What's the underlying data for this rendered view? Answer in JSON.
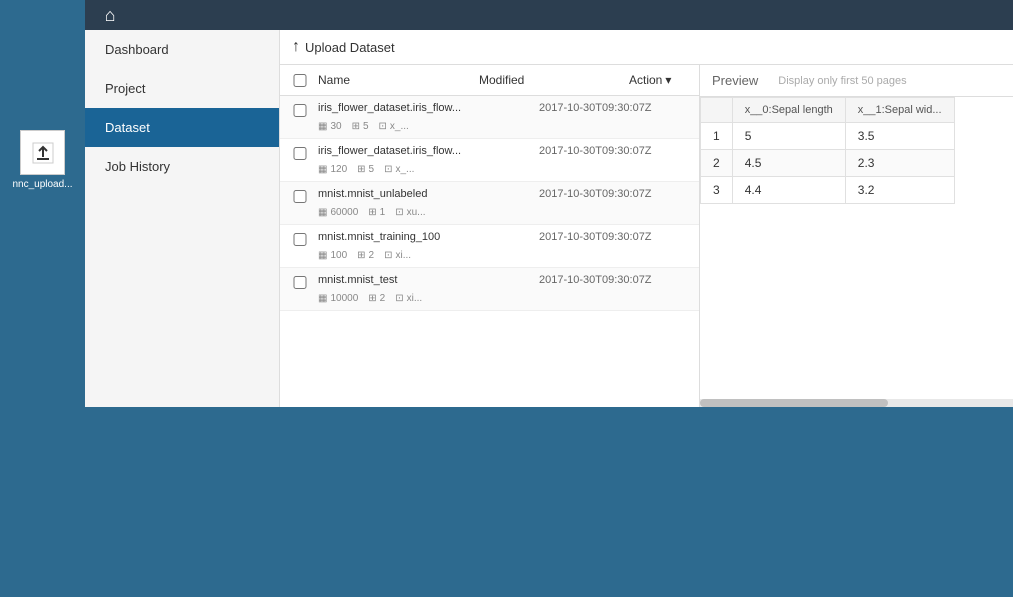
{
  "topbar": {
    "home_icon": "⌂"
  },
  "sidebar": {
    "items": [
      {
        "label": "Dashboard",
        "active": false
      },
      {
        "label": "Project",
        "active": false
      },
      {
        "label": "Dataset",
        "active": true
      },
      {
        "label": "Job History",
        "active": false
      }
    ]
  },
  "toolbar": {
    "upload_label": "Upload Dataset",
    "upload_icon": "↑"
  },
  "table": {
    "headers": {
      "name": "Name",
      "modified": "Modified",
      "action": "Action"
    },
    "rows": [
      {
        "name": "iris_flower_dataset.iris_flow...",
        "modified": "2017-10-30T09:30:07Z",
        "rows": "30",
        "cols": "5",
        "file": "x_..."
      },
      {
        "name": "iris_flower_dataset.iris_flow...",
        "modified": "2017-10-30T09:30:07Z",
        "rows": "120",
        "cols": "5",
        "file": "x_..."
      },
      {
        "name": "mnist.mnist_unlabeled",
        "modified": "2017-10-30T09:30:07Z",
        "rows": "60000",
        "cols": "1",
        "file": "xu..."
      },
      {
        "name": "mnist.mnist_training_100",
        "modified": "2017-10-30T09:30:07Z",
        "rows": "100",
        "cols": "2",
        "file": "xi..."
      },
      {
        "name": "mnist.mnist_test",
        "modified": "2017-10-30T09:30:07Z",
        "rows": "10000",
        "cols": "2",
        "file": "xi..."
      }
    ]
  },
  "preview": {
    "title": "Preview",
    "note": "Display only first 50 pages",
    "columns": [
      {
        "label": ""
      },
      {
        "label": "x__0:Sepal length"
      },
      {
        "label": "x__1:Sepal wid..."
      }
    ],
    "rows": [
      {
        "idx": "1",
        "col0": "5",
        "col1": "3.5"
      },
      {
        "idx": "2",
        "col0": "4.5",
        "col1": "2.3"
      },
      {
        "idx": "3",
        "col0": "4.4",
        "col1": "3.2"
      }
    ]
  },
  "desktop_icon": {
    "label": "nnc_upload..."
  }
}
